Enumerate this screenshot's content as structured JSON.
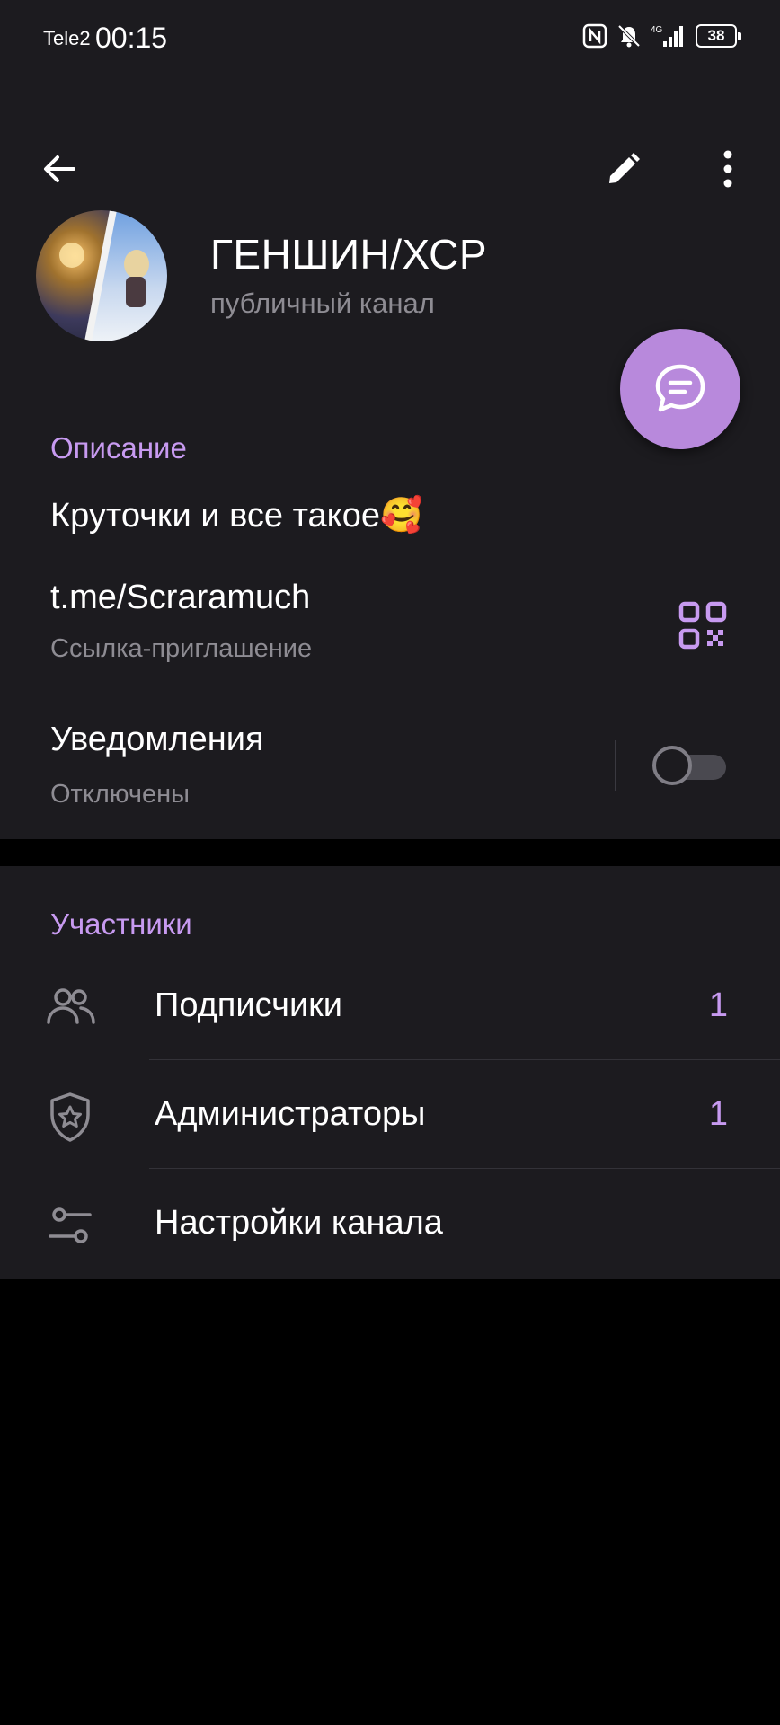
{
  "status_bar": {
    "carrier": "Tele2",
    "time": "00:15",
    "battery": "38",
    "network": "4G"
  },
  "toolbar": {
    "back_icon": "arrow-left-icon",
    "edit_icon": "pencil-icon",
    "more_icon": "more-vertical-icon"
  },
  "channel": {
    "title": "ГЕНШИН/ХСР",
    "subtitle": "публичный канал"
  },
  "info": {
    "heading": "Описание",
    "description": "Круточки и все такое🥰",
    "link": "t.me/Scraramuch",
    "link_caption": "Ссылка-приглашение",
    "notifications_label": "Уведомления",
    "notifications_state": "Отключены",
    "notifications_enabled": false
  },
  "members": {
    "heading": "Участники",
    "rows": [
      {
        "label": "Подписчики",
        "count": "1",
        "icon": "people-icon"
      },
      {
        "label": "Администраторы",
        "count": "1",
        "icon": "shield-star-icon"
      },
      {
        "label": "Настройки канала",
        "count": "",
        "icon": "sliders-icon"
      }
    ]
  },
  "colors": {
    "accent": "#c79af0",
    "fab": "#b889dc",
    "surface": "#1c1b1f",
    "background": "#000000",
    "secondary_text": "#8e8c93"
  }
}
